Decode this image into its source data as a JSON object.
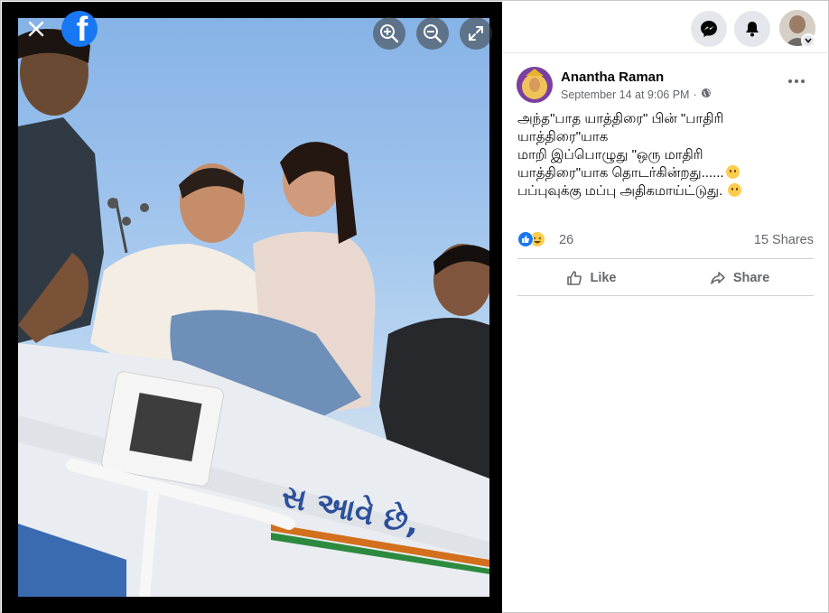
{
  "viewer": {
    "close_icon": "close-icon",
    "logo_icon": "facebook-logo",
    "logo_letter": "f",
    "zoom_in_icon": "zoom-in-icon",
    "zoom_out_icon": "zoom-out-icon",
    "fullscreen_icon": "expand-icon",
    "photo_sign_text": "સ આવે છે,"
  },
  "topbar": {
    "messenger_icon": "messenger-icon",
    "notifications_icon": "bell-icon",
    "account_icon": "chevron-down-icon"
  },
  "post": {
    "author": "Anantha Raman",
    "timestamp": "September 14 at 9:06 PM",
    "separator": "·",
    "audience_icon": "globe-icon",
    "more_icon": "more-horizontal-icon",
    "text_lines": [
      "அந்த\"பாத யாத்திரை\" பின் \"பாதிரி",
      "யாத்திரை\"யாக",
      "மாறி இப்பொழுது \"ஒரு மாதிரி",
      "யாத்திரை\"யாக தொடர்கின்றது......",
      "பப்புவுக்கு மப்பு அதிகமாய்ட்டுது."
    ],
    "reaction_count": "26",
    "shares_label": "15 Shares",
    "like_label": "Like",
    "share_label": "Share"
  },
  "colors": {
    "facebook_blue": "#1877f2",
    "secondary_text": "#65676b",
    "divider": "#ced0d4"
  }
}
